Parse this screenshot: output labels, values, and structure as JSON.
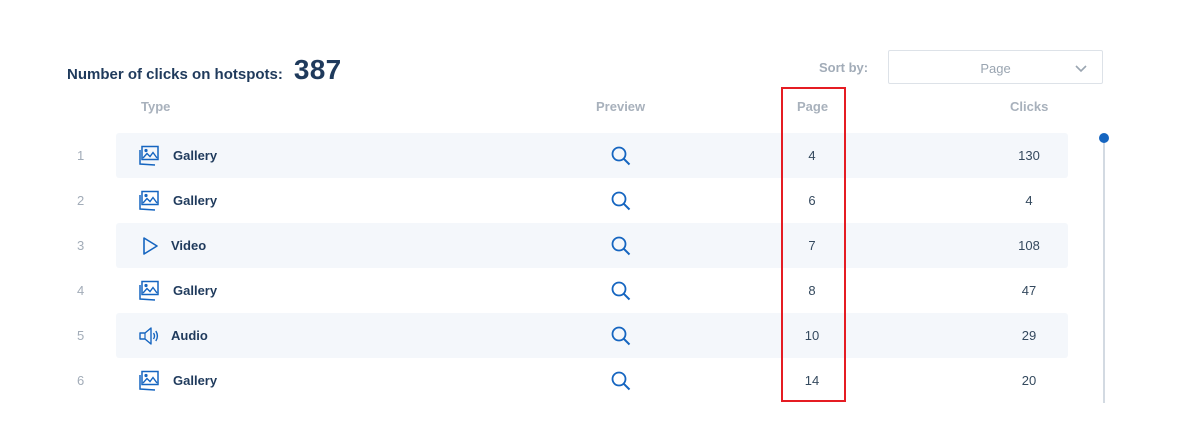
{
  "summary": {
    "label": "Number of clicks on hotspots:",
    "value": "387"
  },
  "sort": {
    "label": "Sort by:",
    "value": "Page"
  },
  "columns": {
    "type": "Type",
    "preview": "Preview",
    "page": "Page",
    "clicks": "Clicks"
  },
  "rows": [
    {
      "num": "1",
      "type": "Gallery",
      "icon": "gallery-icon",
      "page": "4",
      "clicks": "130"
    },
    {
      "num": "2",
      "type": "Gallery",
      "icon": "gallery-icon",
      "page": "6",
      "clicks": "4"
    },
    {
      "num": "3",
      "type": "Video",
      "icon": "play-icon",
      "page": "7",
      "clicks": "108"
    },
    {
      "num": "4",
      "type": "Gallery",
      "icon": "gallery-icon",
      "page": "8",
      "clicks": "47"
    },
    {
      "num": "5",
      "type": "Audio",
      "icon": "speaker-icon",
      "page": "10",
      "clicks": "29"
    },
    {
      "num": "6",
      "type": "Gallery",
      "icon": "gallery-icon",
      "page": "14",
      "clicks": "20"
    }
  ],
  "colors": {
    "accent": "#1565c0",
    "highlight": "#e51c23",
    "row_bg": "#f4f7fb",
    "text": "#1f3a5c"
  }
}
